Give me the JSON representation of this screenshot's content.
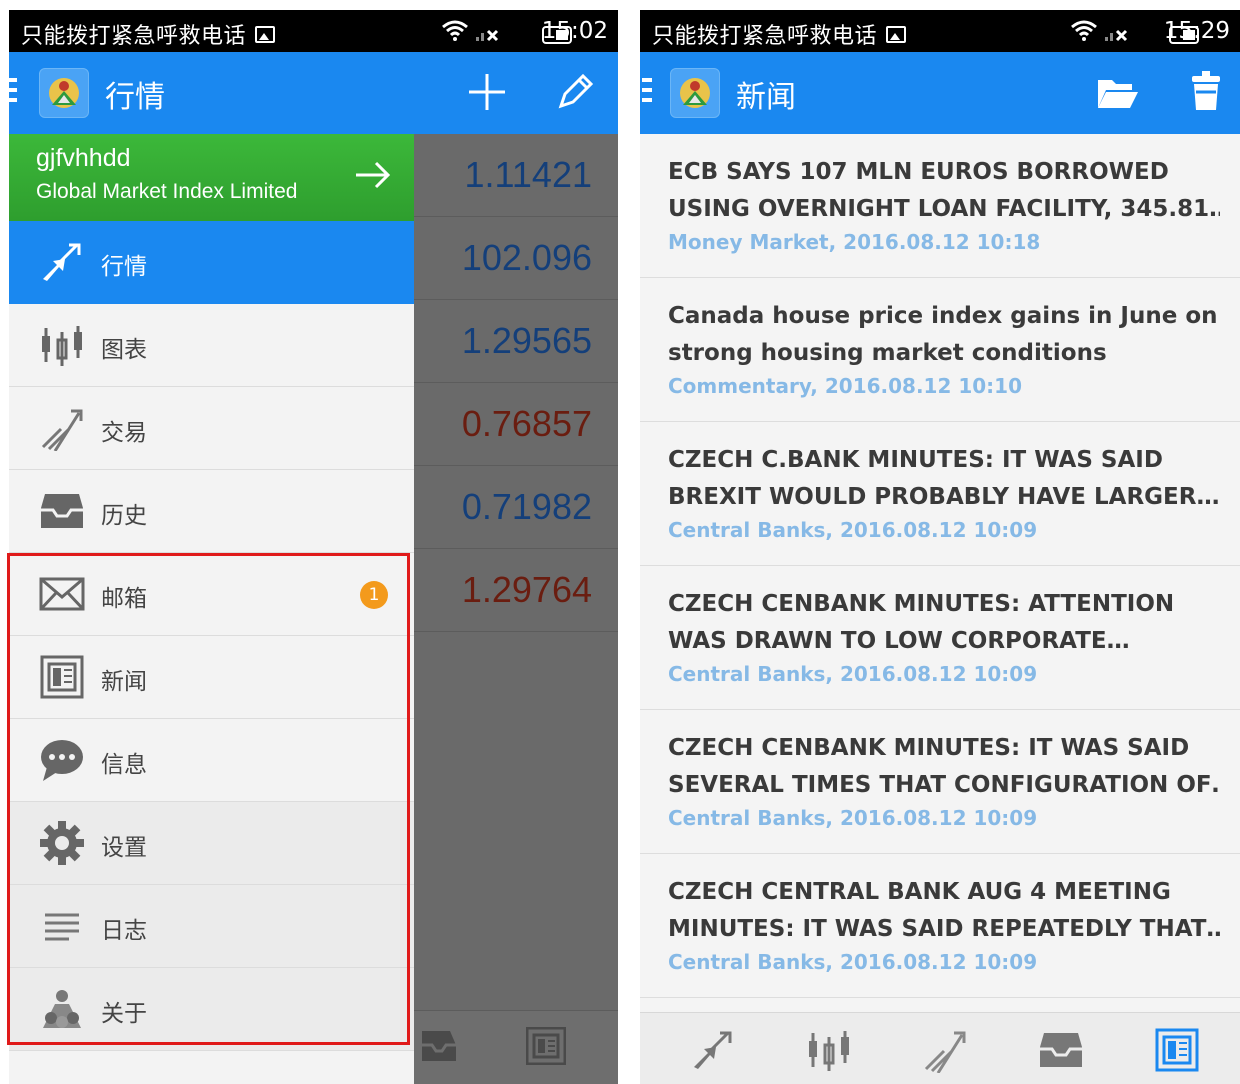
{
  "left_screen": {
    "status": {
      "carrier": "只能拨打紧急呼救电话",
      "time": "15:02"
    },
    "appbar": {
      "title": "行情"
    },
    "account": {
      "name": "gjfvhhdd",
      "company": "Global Market Index Limited"
    },
    "quotes": [
      {
        "value": "1.11421",
        "color": "blue"
      },
      {
        "value": "102.096",
        "color": "blue"
      },
      {
        "value": "1.29565",
        "color": "blue"
      },
      {
        "value": "0.76857",
        "color": "red"
      },
      {
        "value": "0.71982",
        "color": "blue"
      },
      {
        "value": "1.29764",
        "color": "red"
      }
    ],
    "menu": [
      {
        "label": "行情",
        "icon": "quotes-arrows-icon",
        "active": true
      },
      {
        "label": "图表",
        "icon": "candlestick-chart-icon"
      },
      {
        "label": "交易",
        "icon": "trade-trend-icon"
      },
      {
        "label": "历史",
        "icon": "inbox-history-icon"
      },
      {
        "label": "邮箱",
        "icon": "envelope-icon",
        "badge": "1"
      },
      {
        "label": "新闻",
        "icon": "newspaper-icon"
      },
      {
        "label": "信息",
        "icon": "chat-bubble-icon"
      },
      {
        "label": "设置",
        "icon": "gear-icon"
      },
      {
        "label": "日志",
        "icon": "log-lines-icon"
      },
      {
        "label": "关于",
        "icon": "about-logo-icon"
      }
    ]
  },
  "right_screen": {
    "status": {
      "carrier": "只能拨打紧急呼救电话",
      "time": "15:29"
    },
    "appbar": {
      "title": "新闻"
    },
    "news": [
      {
        "line1": "ECB SAYS 107 MLN EUROS BORROWED",
        "line2": "USING OVERNIGHT LOAN FACILITY, 345.81…",
        "meta": "Money Market, 2016.08.12 10:18"
      },
      {
        "line1": "Canada house price index gains in June on",
        "line2": "strong housing market conditions",
        "meta": "Commentary, 2016.08.12 10:10"
      },
      {
        "line1": "CZECH C.BANK MINUTES: IT WAS SAID",
        "line2": "BREXIT WOULD PROBABLY HAVE LARGER…",
        "meta": "Central Banks, 2016.08.12 10:09"
      },
      {
        "line1": "CZECH CENBANK MINUTES: ATTENTION",
        "line2": "WAS DRAWN TO LOW CORPORATE…",
        "meta": "Central Banks, 2016.08.12 10:09"
      },
      {
        "line1": "CZECH CENBANK MINUTES: IT WAS SAID",
        "line2": "SEVERAL TIMES THAT CONFIGURATION OF…",
        "meta": "Central Banks, 2016.08.12 10:09"
      },
      {
        "line1": "CZECH CENTRAL BANK AUG 4 MEETING",
        "line2": "MINUTES: IT WAS SAID REPEATEDLY THAT…",
        "meta": "Central Banks, 2016.08.12 10:09"
      }
    ]
  },
  "colors": {
    "primary": "#1a88f0",
    "account_green": "#34a834",
    "highlight_box": "#e01a1a",
    "badge": "#f39a1c",
    "meta_blue": "#86b9e6"
  }
}
